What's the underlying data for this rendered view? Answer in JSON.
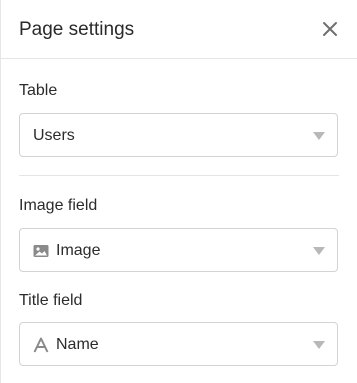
{
  "header": {
    "title": "Page settings",
    "close_icon": "close-icon"
  },
  "table_section": {
    "label": "Table",
    "selected": "Users"
  },
  "image_field": {
    "label": "Image field",
    "selected": "Image",
    "icon": "image-icon"
  },
  "title_field": {
    "label": "Title field",
    "selected": "Name",
    "icon": "text-field-icon"
  },
  "colors": {
    "border": "#d3d3d3",
    "divider": "#e5e5e5",
    "caret": "#b8b8b8",
    "icon": "#8a8a8a"
  }
}
